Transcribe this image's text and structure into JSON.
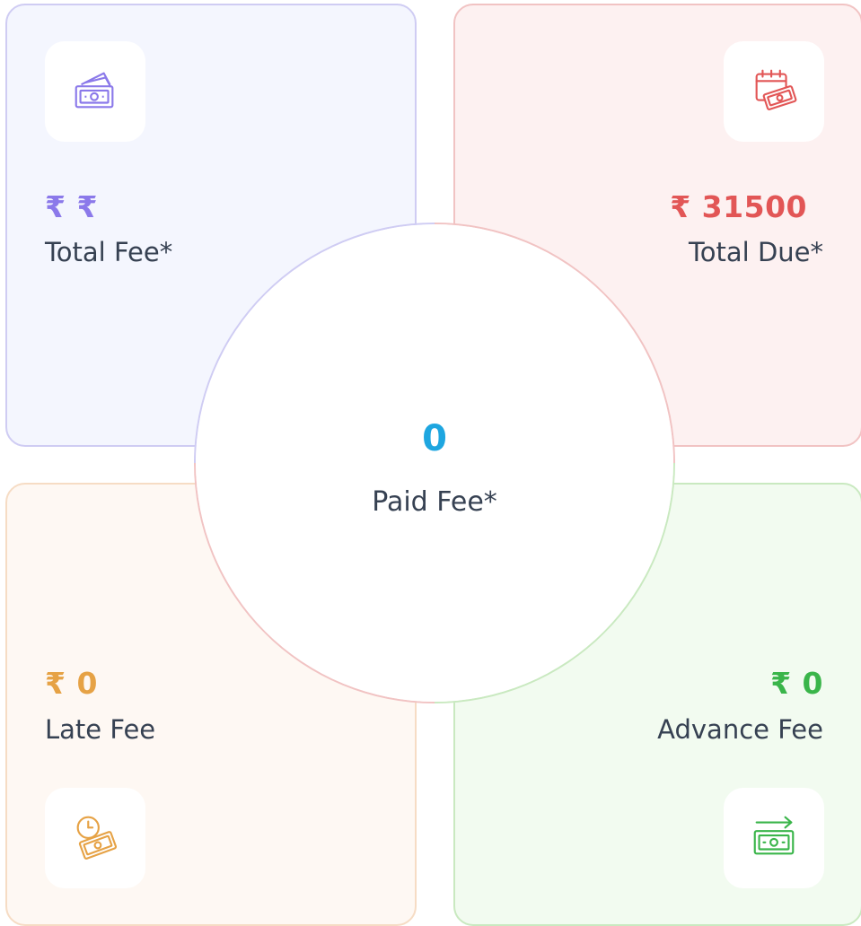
{
  "cards": {
    "total_fee": {
      "amount": "₹ ₹",
      "label": "Total Fee*",
      "icon": "money-notes-icon",
      "accent_color": "#8b79ea",
      "background_color": "#f4f6fe"
    },
    "total_due": {
      "amount": "₹ 31500",
      "label": "Total Due*",
      "icon": "calendar-money-icon",
      "accent_color": "#e25656",
      "background_color": "#fdf1f1"
    },
    "late_fee": {
      "amount": "₹ 0",
      "label": "Late Fee",
      "icon": "clock-money-icon",
      "accent_color": "#e6a245",
      "background_color": "#fef8f3"
    },
    "advance_fee": {
      "amount": "₹ 0",
      "label": "Advance Fee",
      "icon": "money-arrow-icon",
      "accent_color": "#3ab54a",
      "background_color": "#f2fbf0"
    }
  },
  "center": {
    "paid_value": "0",
    "paid_label": "Paid Fee*",
    "accent_color": "#1ea6e0"
  }
}
